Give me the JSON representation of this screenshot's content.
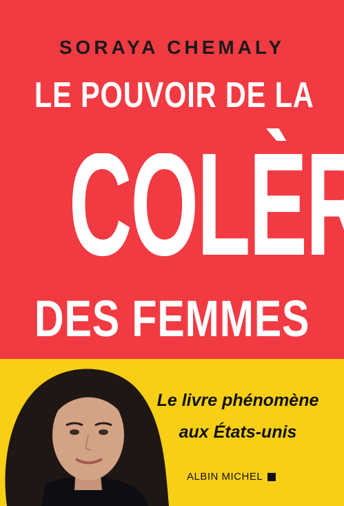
{
  "colors": {
    "top_background": "#F23A43",
    "band_background": "#F8CF14",
    "title_text": "#FFFFFF",
    "dark_text": "#111111"
  },
  "cover": {
    "author": "SORAYA CHEMALY",
    "title": {
      "line1": "LE POUVOIR DE LA",
      "line2": "COLÈRE",
      "line3": "DES FEMMES"
    },
    "tagline": {
      "line1": "Le livre phénomène",
      "line2": "aux États-unis"
    },
    "publisher": "ALBIN MICHEL"
  }
}
